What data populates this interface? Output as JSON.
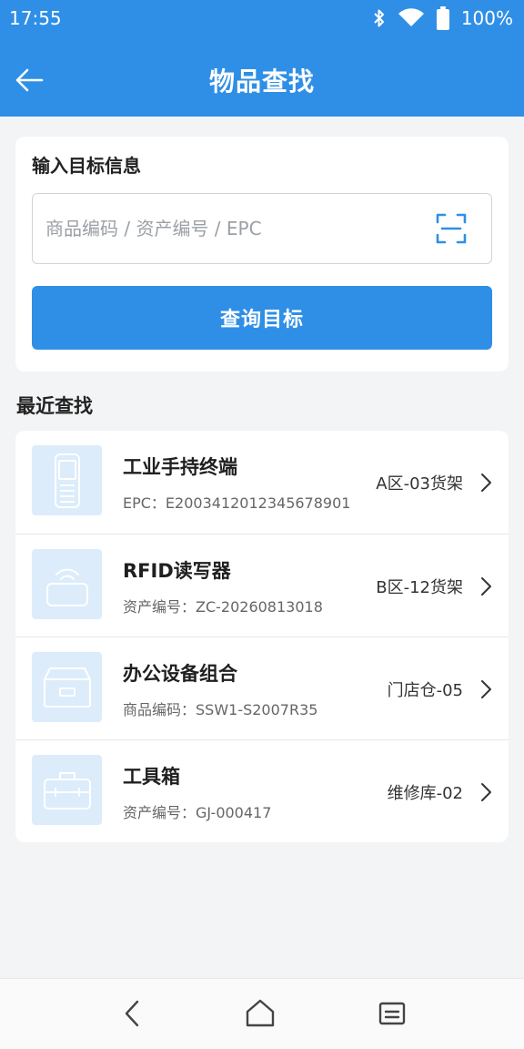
{
  "status_bar": {
    "time": "17:55",
    "battery": "100%",
    "icons": [
      "bluetooth-icon",
      "wifi-icon",
      "battery-icon"
    ]
  },
  "header": {
    "title": "物品查找",
    "back_icon": "arrow-left-icon"
  },
  "search": {
    "section_label": "输入目标信息",
    "placeholder": "商品编码 / 资产编号 / EPC",
    "value": "",
    "scan_icon": "scan-icon",
    "button_label": "查询目标"
  },
  "recent": {
    "title": "最近查找",
    "items": [
      {
        "name": "工业手持终端",
        "code": "EPC：E2003412012345678901",
        "location": "A区-03货架",
        "icon": "handheld-terminal-icon"
      },
      {
        "name": "RFID读写器",
        "code": "资产编号：ZC-20260813018",
        "location": "B区-12货架",
        "icon": "rfid-reader-icon"
      },
      {
        "name": "办公设备组合",
        "code": "商品编码：SSW1-S2007R35",
        "location": "门店仓-05",
        "icon": "storage-box-icon"
      },
      {
        "name": "工具箱",
        "code": "资产编号：GJ-000417",
        "location": "维修库-02",
        "icon": "toolbox-icon"
      }
    ]
  },
  "nav": {
    "icons": [
      "nav-back-icon",
      "nav-home-icon",
      "nav-recents-icon"
    ]
  },
  "colors": {
    "primary": "#2f8fe6",
    "thumb_bg": "#dcecfb",
    "background": "#f3f4f6"
  }
}
